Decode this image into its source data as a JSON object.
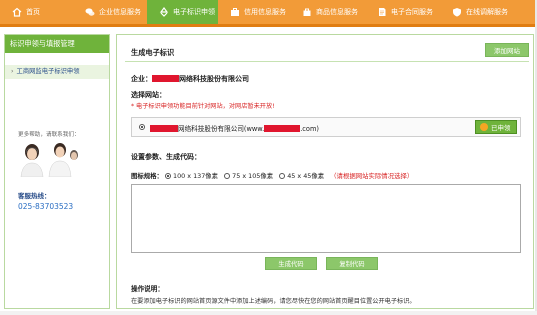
{
  "nav": {
    "items": [
      {
        "label": "首页",
        "icon": "home-icon",
        "active": false
      },
      {
        "label": "企业信息服务",
        "icon": "chat-bubbles-icon",
        "active": false
      },
      {
        "label": "电子标识申领",
        "icon": "recycle-icon",
        "active": true
      },
      {
        "label": "信用信息服务",
        "icon": "briefcase-icon",
        "active": false
      },
      {
        "label": "商品信息服务",
        "icon": "bag-icon",
        "active": false
      },
      {
        "label": "电子合同服务",
        "icon": "document-icon",
        "active": false
      },
      {
        "label": "在线调解服务",
        "icon": "shield-icon",
        "active": false
      }
    ],
    "color": "#f29b38",
    "active_color": "#6fb33b"
  },
  "sidebar": {
    "title": "标识申领与填报管理",
    "items": [
      {
        "label": "工商网监电子标识申领"
      }
    ],
    "help_text": "更多帮助，请联系我们：",
    "hotline_label": "客服热线：",
    "hotline_number": "025-83703523"
  },
  "main": {
    "title": "生成电子标识",
    "add_site_button": "添加网站",
    "company_prefix": "企业：",
    "company_suffix": "网络科技股份有限公司",
    "choose_site_label": "选择网站：",
    "warning": "* 电子标识申领功能目前针对网站，对网店暂未开放!",
    "site": {
      "text_middle": "网络科技股份有限公司(www.",
      "text_end": ".com)",
      "selected": true,
      "applied_button": "已申领"
    },
    "params_title": "设置参数、生成代码：",
    "size_label": "图标规格：",
    "size_options": [
      {
        "label": "100 x 137像素",
        "selected": true
      },
      {
        "label": "75 x 105像素",
        "selected": false
      },
      {
        "label": "45 x 45像素",
        "selected": false
      }
    ],
    "size_hint": "（请根据网站实际情况选择）",
    "code_value": "",
    "generate_button": "生成代码",
    "copy_button": "复制代码",
    "ops_title": "操作说明：",
    "ops_text": "在要添加电子标识的网站首页源文件中添加上述编码，请您尽快在您的网站首页醒目位置公开电子标识。"
  }
}
